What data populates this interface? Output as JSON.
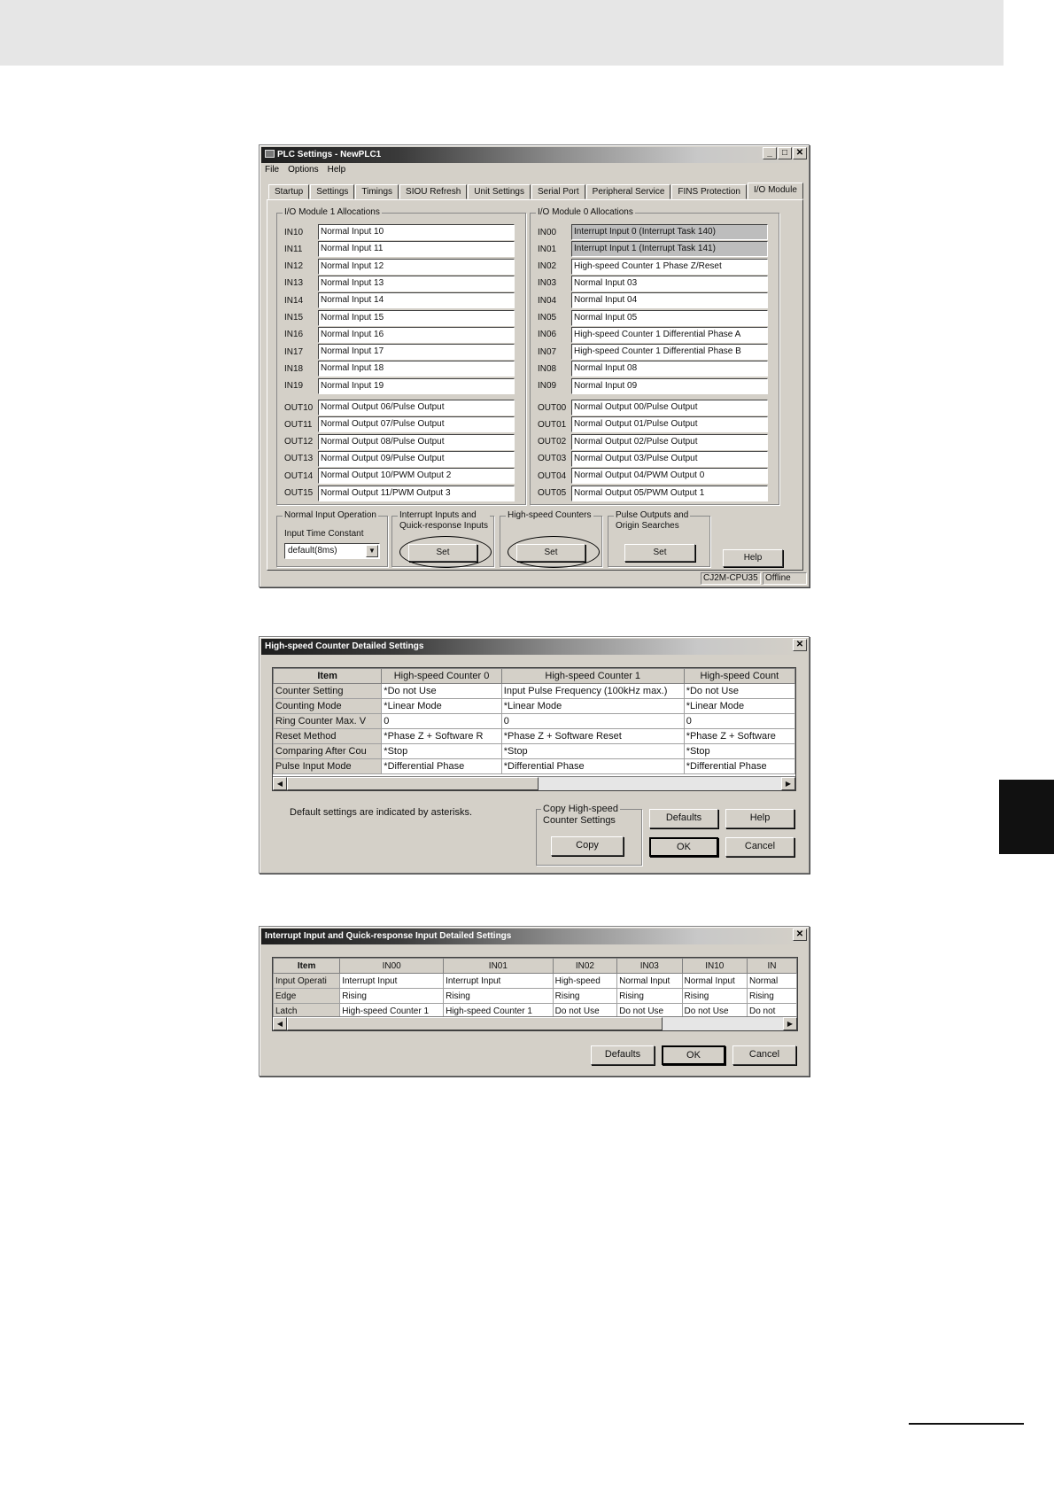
{
  "plc_window": {
    "title": "PLC Settings - NewPLC1",
    "menu": [
      "File",
      "Options",
      "Help"
    ],
    "tabs": [
      "Startup",
      "Settings",
      "Timings",
      "SIOU Refresh",
      "Unit Settings",
      "Serial Port",
      "Peripheral Service",
      "FINS Protection",
      "I/O Module"
    ],
    "module1_label": "I/O Module 1 Allocations",
    "module0_label": "I/O Module 0 Allocations",
    "module1_inputs": [
      {
        "code": "IN10",
        "value": "Normal Input 10"
      },
      {
        "code": "IN11",
        "value": "Normal Input 11"
      },
      {
        "code": "IN12",
        "value": "Normal Input 12"
      },
      {
        "code": "IN13",
        "value": "Normal Input 13"
      },
      {
        "code": "IN14",
        "value": "Normal Input 14"
      },
      {
        "code": "IN15",
        "value": "Normal Input 15"
      },
      {
        "code": "IN16",
        "value": "Normal Input 16"
      },
      {
        "code": "IN17",
        "value": "Normal Input 17"
      },
      {
        "code": "IN18",
        "value": "Normal Input 18"
      },
      {
        "code": "IN19",
        "value": "Normal Input 19"
      }
    ],
    "module1_outputs": [
      {
        "code": "OUT10",
        "value": "Normal Output 06/Pulse Output"
      },
      {
        "code": "OUT11",
        "value": "Normal Output 07/Pulse Output"
      },
      {
        "code": "OUT12",
        "value": "Normal Output 08/Pulse Output"
      },
      {
        "code": "OUT13",
        "value": "Normal Output 09/Pulse Output"
      },
      {
        "code": "OUT14",
        "value": "Normal Output 10/PWM Output 2"
      },
      {
        "code": "OUT15",
        "value": "Normal Output 11/PWM Output 3"
      }
    ],
    "module0_inputs": [
      {
        "code": "IN00",
        "value": "Interrupt Input 0 (Interrupt Task 140)"
      },
      {
        "code": "IN01",
        "value": "Interrupt Input 1 (Interrupt Task 141)"
      },
      {
        "code": "IN02",
        "value": "High-speed Counter 1 Phase Z/Reset"
      },
      {
        "code": "IN03",
        "value": "Normal Input 03"
      },
      {
        "code": "IN04",
        "value": "Normal Input 04"
      },
      {
        "code": "IN05",
        "value": "Normal Input 05"
      },
      {
        "code": "IN06",
        "value": "High-speed Counter 1 Differential Phase A"
      },
      {
        "code": "IN07",
        "value": "High-speed Counter 1 Differential Phase B"
      },
      {
        "code": "IN08",
        "value": "Normal Input 08"
      },
      {
        "code": "IN09",
        "value": "Normal Input 09"
      }
    ],
    "module0_outputs": [
      {
        "code": "OUT00",
        "value": "Normal Output 00/Pulse Output"
      },
      {
        "code": "OUT01",
        "value": "Normal Output 01/Pulse Output"
      },
      {
        "code": "OUT02",
        "value": "Normal Output 02/Pulse Output"
      },
      {
        "code": "OUT03",
        "value": "Normal Output 03/Pulse Output"
      },
      {
        "code": "OUT04",
        "value": "Normal Output 04/PWM Output 0"
      },
      {
        "code": "OUT05",
        "value": "Normal Output 05/PWM Output 1"
      }
    ],
    "normal_input_group": "Normal Input Operation",
    "input_time_constant_label": "Input Time Constant",
    "input_time_constant_value": "default(8ms)",
    "interrupt_group_line1": "Interrupt Inputs and",
    "interrupt_group_line2": "Quick-response Inputs",
    "hsc_group": "High-speed Counters",
    "pulse_group_line1": "Pulse Outputs and",
    "pulse_group_line2": "Origin Searches",
    "set_label": "Set",
    "help_label": "Help",
    "status_model": "CJ2M-CPU35",
    "status_mode": "Offline"
  },
  "hsc_dialog": {
    "title": "High-speed Counter Detailed Settings",
    "headers": [
      "Item",
      "High-speed Counter 0",
      "High-speed Counter 1",
      "High-speed Count"
    ],
    "rows": [
      [
        "Counter Setting",
        "*Do not Use",
        "Input Pulse Frequency (100kHz max.)",
        "*Do not Use"
      ],
      [
        "Counting Mode",
        "*Linear Mode",
        "*Linear Mode",
        "*Linear Mode"
      ],
      [
        "Ring Counter Max. V",
        "0",
        "0",
        "0"
      ],
      [
        "Reset Method",
        "*Phase Z + Software R",
        "*Phase Z + Software Reset",
        "*Phase Z + Software"
      ],
      [
        "Comparing After Cou",
        "*Stop",
        "*Stop",
        "*Stop"
      ],
      [
        "Pulse Input Mode",
        "*Differential Phase",
        "*Differential Phase",
        "*Differential Phase"
      ]
    ],
    "note": "Default settings are indicated by asterisks.",
    "copy_group_line1": "Copy High-speed",
    "copy_group_line2": "Counter Settings",
    "copy_label": "Copy",
    "defaults_label": "Defaults",
    "help_label": "Help",
    "ok_label": "OK",
    "cancel_label": "Cancel"
  },
  "irq_dialog": {
    "title": "Interrupt Input and Quick-response Input Detailed Settings",
    "headers": [
      "Item",
      "IN00",
      "IN01",
      "IN02",
      "IN03",
      "IN10",
      "IN"
    ],
    "rows": [
      [
        "Input Operati",
        "Interrupt Input",
        "Interrupt Input",
        "High-speed",
        "Normal Input",
        "Normal Input",
        "Normal"
      ],
      [
        "Edge",
        "Rising",
        "Rising",
        "Rising",
        "Rising",
        "Rising",
        "Rising"
      ],
      [
        "Latch",
        "High-speed Counter 1",
        "High-speed Counter 1",
        "Do not Use",
        "Do not Use",
        "Do not Use",
        "Do not"
      ]
    ],
    "defaults_label": "Defaults",
    "ok_label": "OK",
    "cancel_label": "Cancel"
  },
  "colors": {
    "window_face": "#d4d0c8",
    "highlight_field": "#bdbdbd",
    "side_tab": "#111111"
  }
}
